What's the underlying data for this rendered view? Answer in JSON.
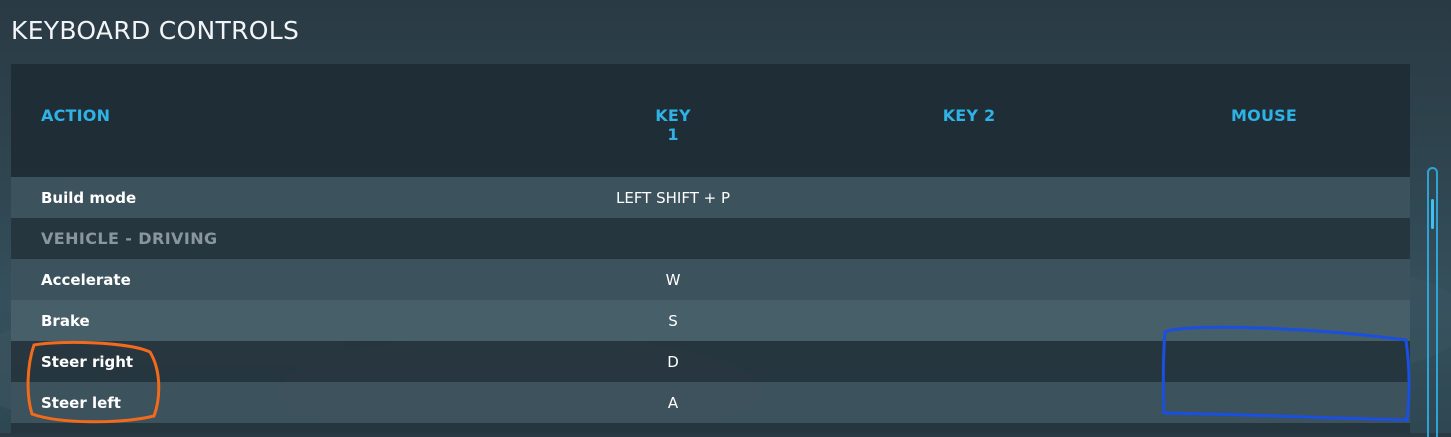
{
  "page": {
    "title": "KEYBOARD CONTROLS"
  },
  "table": {
    "headers": {
      "action": "ACTION",
      "key1": "KEY 1",
      "key2": "KEY 2",
      "mouse": "MOUSE"
    },
    "rows": [
      {
        "action": "Build mode",
        "key1": "LEFT SHIFT + P",
        "key2": "",
        "mouse": "",
        "is_category": false
      },
      {
        "action": "VEHICLE - DRIVING",
        "key1": "",
        "key2": "",
        "mouse": "",
        "is_category": true
      },
      {
        "action": "Accelerate",
        "key1": "W",
        "key2": "",
        "mouse": "",
        "is_category": false
      },
      {
        "action": "Brake",
        "key1": "S",
        "key2": "",
        "mouse": "",
        "is_category": false
      },
      {
        "action": "Steer right",
        "key1": "D",
        "key2": "",
        "mouse": "",
        "is_category": false
      },
      {
        "action": "Steer left",
        "key1": "A",
        "key2": "",
        "mouse": "",
        "is_category": false
      }
    ]
  },
  "colors": {
    "accent": "#2fb3e6",
    "annotation_orange": "#f26a1b",
    "annotation_blue": "#1a4fe0"
  },
  "icons": {
    "scrollbar": "vertical-scrollbar"
  }
}
